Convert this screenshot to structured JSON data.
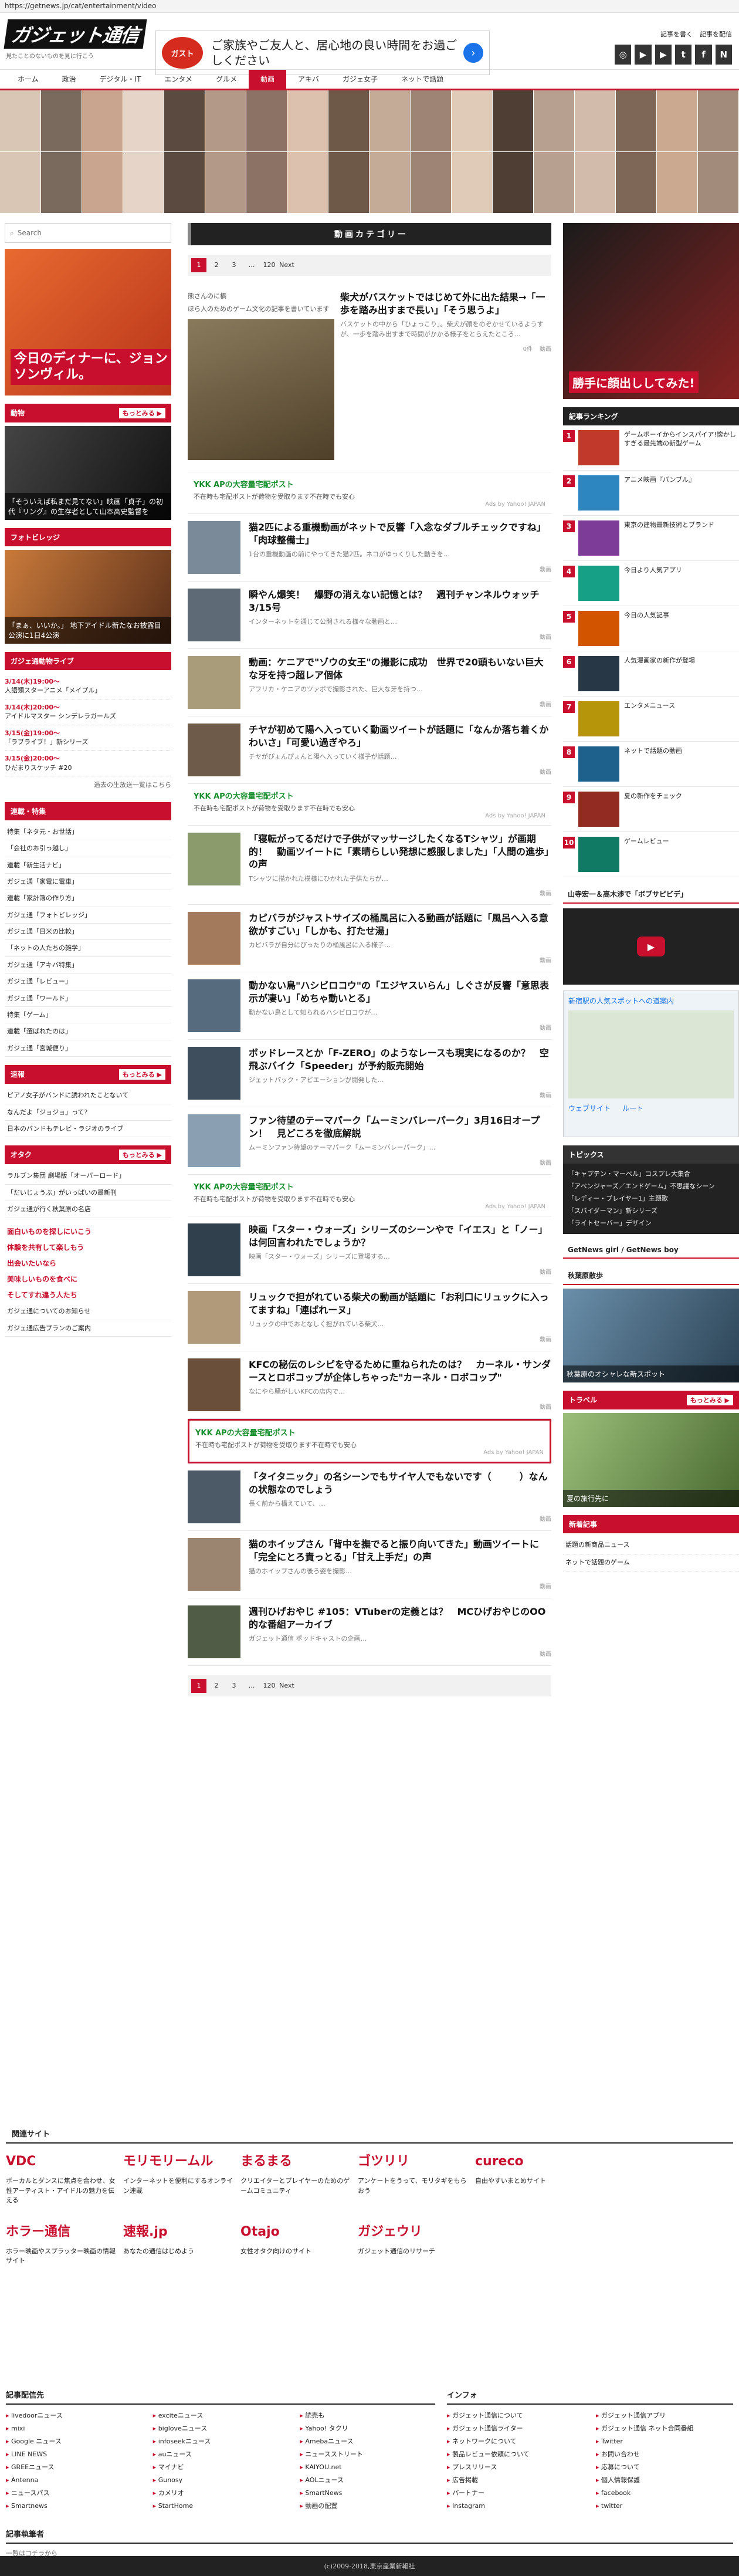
{
  "url": "https://getnews.jp/cat/entertainment/video",
  "header": {
    "logo": "ガジェット通信",
    "tagline": "見たことのないものを見に行こう",
    "ad_brand": "ガスト",
    "ad_text": "ご家族やご友人と、居心地の良い時間をお過ごしください",
    "ad_arrow": "›",
    "links": [
      "記事を書く",
      "記事を配信"
    ],
    "socials": [
      "◎",
      "▶",
      "▶",
      "t",
      "f",
      "N"
    ]
  },
  "nav": [
    "ホーム",
    "政治",
    "デジタル・IT",
    "エンタメ",
    "グルメ",
    "動画",
    "アキバ",
    "ガジェ女子",
    "ネットで話題"
  ],
  "search": {
    "placeholder": "Search"
  },
  "left": {
    "ad_text": "今日のディナーに、ジョンソンヴィル。",
    "animals_head": "動物",
    "animals_more": "もっとみる ▶",
    "animals_cap": "「そういえば私まだ見てない」映画「貞子」の初代『リング』の生存者として山本高史監督を",
    "photo_head": "フォトビレッジ",
    "photo_cap": "「まぁ、いいか。」 地下アイドル新たなお披露目公演に1日4公演",
    "comic_head": "ガジェ通動物ライブ",
    "comic": [
      {
        "d": "3/14(木)19:00〜",
        "t": "人語類スターアニメ「メイプル」"
      },
      {
        "d": "3/14(木)20:00〜",
        "t": "アイドルマスター シンデレラガールズ"
      },
      {
        "d": "3/15(金)19:00〜",
        "t": "「ラブライブ！」新シリーズ"
      },
      {
        "d": "3/15(金)20:00〜",
        "t": "ひだまりスケッチ #20"
      }
    ],
    "comic_more": "過去の生放送一覧はこちら",
    "series_head": "連載・特集",
    "series": [
      "特集「ネタ元・お世話」",
      "「会社のお引っ越し」",
      "連載「新生活ナビ」",
      "ガジェ通「家電に電車」",
      "連載「家計簿の作り方」",
      "ガジェ通「フォトビレッジ」",
      "ガジェ通「日米の比較」",
      "「ネットの人たちの雑学」",
      "ガジェ通「アキバ特集」",
      "ガジェ通「レビュー」",
      "ガジェ通「ワールド」",
      "特集「ゲーム」",
      "連載「選ばれたのは」",
      "ガジェ通「宮城便り」"
    ],
    "news_head": "速報",
    "news_more": "もっとみる ▶",
    "news": [
      "ピアノ女子がバンドに誘われたことないて",
      "なんだよ「ジョジョ」って?",
      "日本のバンドもテレビ・ラジオのライブ"
    ],
    "otaku_head": "オタク",
    "otaku_more": "もっとみる ▶",
    "otaku": [
      "ラルブン集団 劇場版「オーバーロード」",
      "「だいじょうぶ」がいっぱいの最新刊",
      "ガジェ通が行く秋葉原の名店"
    ],
    "links_red": [
      "面白いものを探しにいこう",
      "体験を共有して楽しもう",
      "出会いたいなら",
      "美味しいものを食べに",
      "そしてすれ違う人たち"
    ],
    "links_gray": [
      "ガジェ通についてのお知らせ",
      "ガジェ通広告プランのご案内"
    ]
  },
  "main": {
    "category_head": "動画カテゴリー",
    "pager": [
      "1",
      "2",
      "3",
      "…",
      "120",
      "Next"
    ],
    "feat": {
      "author": "熊さんのに橋",
      "author_note": "ほら人のためのゲーム文化の記事を書いています",
      "title": "柴犬がバスケットではじめて外に出た結果→「一歩を踏み出すまで長い」「そう思うよ」",
      "desc": "バスケットの中から「ひょっこり」。柴犬が顔をのぞかせているようすが、一歩を踏み出すまで時間がかかる様子をとらえたところ…",
      "meta1": "0件",
      "meta2": "動画"
    },
    "articles": [
      {
        "t": "猫2匹による重機動画がネットで反響「入念なダブルチェックですね」「肉球整備士」",
        "d": "1台の重機動画の前にやってきた猫2匹。ネコがゆっくりした動きを…",
        "m": "動画"
      },
      {
        "t": "瞬やん爆笑！　爆野の消えない記憶とは？　週刊チャンネルウォッチ 3/15号",
        "d": "インターネットを通じて公開される様々な動画と…",
        "m": "動画"
      },
      {
        "t": "動画：ケニアで\"ゾウの女王\"の撮影に成功　世界で20頭もいない巨大な牙を持つ超レア個体",
        "d": "アフリカ・ケニアのツァボで撮影された、巨大な牙を持つ…",
        "m": "動画"
      },
      {
        "t": "チヤが初めて陽へ入っていく動画ツイートが話題に「なんか落ち着くかわいさ」「可愛い過ぎやろ」",
        "d": "チヤがぴょんぴょんと陽へ入っていく様子が話題…",
        "m": "動画"
      },
      {
        "t": "「寝転がってるだけで子供がマッサージしたくなるTシャツ」が画期的！　動画ツイートに「素晴らしい発想に感服しました」「人間の進歩」の声",
        "d": "Tシャツに描かれた模様にひかれた子供たちが…",
        "m": "動画"
      },
      {
        "t": "カピバラがジャストサイズの桶風呂に入る動画が話題に「風呂へ入る意欲がすごい」「しかも、打たせ湯」",
        "d": "カピバラが自分にぴったりの桶風呂に入る様子…",
        "m": "動画"
      },
      {
        "t": "動かない鳥\"ハシビロコウ\"の「エジヤスいらん」しぐさが反響「意思表示が凄い」「めちゃ動いとる」",
        "d": "動かない鳥として知られるハシビロコウが…",
        "m": "動画"
      },
      {
        "t": "ボッドレースとか「F-ZERO」のようなレースも現実になるのか？　空飛ぶバイク「Speeder」が予約販売開始",
        "d": "ジェットパック・アビエーションが開発した…",
        "m": "動画"
      },
      {
        "t": "ファン待望のテーマパーク「ムーミンバレーパーク」3月16日オープン！　見どころを徹底解説",
        "d": "ムーミンファン待望のテーマパーク「ムーミンバレーパーク」…",
        "m": "動画"
      },
      {
        "t": "映画「スター・ウォーズ」シリーズのシーンやで「イエス」と「ノー」は何回言われたでしょうか？",
        "d": "映画「スター・ウォーズ」シリーズに登場する…",
        "m": "動画"
      },
      {
        "t": "リュックで担がれている柴犬の動画が話題に「お利口にリュックに入ってますね」「連ばれーヌ」",
        "d": "リュックの中でおとなしく担がれている柴犬…",
        "m": "動画"
      },
      {
        "t": "KFCの秘伝のレシピを守るために重ねられたのは？　カーネル・サンダースとロボコップが企体しちゃった\"カーネル・ロボコップ\"",
        "d": "なにやら騒がしいKFCの店内で…",
        "m": "動画"
      },
      {
        "t": "「タイタニック」の名シーンでもサイヤ人でもないです（　　　）なんの状態なのでしょう",
        "d": "長く前から構えていて、…",
        "m": "動画"
      },
      {
        "t": "猫のホイップさん「背中を撫でると振り向いてきた」動画ツイートに「完全にとろ責っとる」「甘え上手だ」の声",
        "d": "猫のホイップさんの後ろ姿を撮影…",
        "m": "動画"
      },
      {
        "t": "週刊ひげおやじ #105：VTuberの定義とは？　MCひげおやじのOO的な番組アーカイブ",
        "d": "ガジェット通信 ポッドキャストの企画…",
        "m": "動画"
      }
    ],
    "ad": {
      "t": "YKK APの大容量宅配ポスト",
      "d": "不在時も宅配ポストが荷物を受取ります不在時でも安心",
      "s": "Ads by Yahoo! JAPAN"
    }
  },
  "right": {
    "ad_text": "勝手に顔出ししてみた!",
    "rank_head": "記事ランキング",
    "ranks": [
      "ゲームボーイからインスパイア!懐かしすぎる最先端の新型ゲーム",
      "アニメ映画『バンブル』",
      "東京の建物最新技術とブランド",
      "今日より人気アプリ",
      "今日の人気記事",
      "人気漫画家の新作が登場",
      "エンタメニュース",
      "ネットで話題の動画",
      "夏の新作をチェック",
      "ゲームレビュー"
    ],
    "video_head": "山寺宏一＆高木渉で「ボブサピビデ」",
    "map_text": "新宿駅の人気スポットへの道案内",
    "map_btns": [
      "ウェブサイト",
      "ルート"
    ],
    "topics_head": "トピックス",
    "topics": [
      "「キャプテン・マーベル」コスプレ大集合",
      "「アベンジャーズ／エンドゲーム」不思議なシーン",
      "「レディー・プレイヤー1」主題歌",
      "「スパイダーマン」新シリーズ",
      "「ライトセーバー」デザイン"
    ],
    "getnews": "GetNews girl / GetNews boy",
    "trip_head": "秋葉原散歩",
    "trip_cap": "秋葉原のオシャレな新スポット",
    "travel_head": "トラベル",
    "travel_more": "もっとみる ▶",
    "travel_cap": "夏の旅行先に",
    "recent_head": "新着記事",
    "recent": [
      "話題の新商品ニュース",
      "ネットで話題のゲーム"
    ]
  },
  "footer": {
    "sites_head": "関連サイト",
    "sites": [
      {
        "n": "VDC",
        "d": "ボーカルとダンスに焦点を合わせ、女性アーティスト・アイドルの魅力を伝える"
      },
      {
        "n": "モリモリームル",
        "d": "インターネットを便利にするオンライン連載"
      },
      {
        "n": "まるまる",
        "d": "クリエイターとプレイヤーのためのゲームコミュニティ"
      },
      {
        "n": "ゴツリリ",
        "d": "アンケートをうって、モリタギをもらおう"
      },
      {
        "n": "cureco",
        "d": "自由やすいまとめサイト"
      }
    ],
    "sites2": [
      {
        "n": "ホラー通信",
        "d": "ホラー映画やスプラッター映画の情報サイト"
      },
      {
        "n": "速報.jp",
        "d": "あなたの通信はじめよう"
      },
      {
        "n": "Otajo",
        "d": "女性オタク向けのサイト"
      },
      {
        "n": "ガジェウリ",
        "d": "ガジェット通信のリサーチ"
      }
    ],
    "providers_head": "記事配信先",
    "providers": [
      [
        "livedoorニュース",
        "mixi",
        "Google ニュース",
        "LINE NEWS",
        "GREEニュース",
        "Antenna",
        "ニュースパス",
        "Smartnews"
      ],
      [
        "exciteニュース",
        "bigloveニュース",
        "infoseekニュース",
        "auニュース",
        "マイナビ",
        "Gunosy",
        "カメリオ",
        "StartHome"
      ],
      [
        "読売も",
        "Yahoo! タクリ",
        "Amebaニュース",
        "ニュースストリート",
        "KAIYOU.net",
        "AOLニュース",
        "SmartNews",
        "動画の配置"
      ]
    ],
    "info_head": "インフォ",
    "info": [
      [
        "ガジェット通信について",
        "ガジェット通信ライター",
        "ネットワークについて",
        "製品レビュー依頼について",
        "プレスリリース",
        "広告掲載",
        "パートナー",
        "Instagram"
      ],
      [
        "ガジェット通信アプリ",
        "ガジェット通信 ネット合同番組",
        "Twitter",
        "お問い合わせ",
        "応募について",
        "個人情報保護",
        "facebook",
        "twitter"
      ]
    ],
    "writers_head": "記事執筆者",
    "writers_link": "一覧はコチラから",
    "copyright": "(c)2009-2018,東京産業新報社"
  }
}
